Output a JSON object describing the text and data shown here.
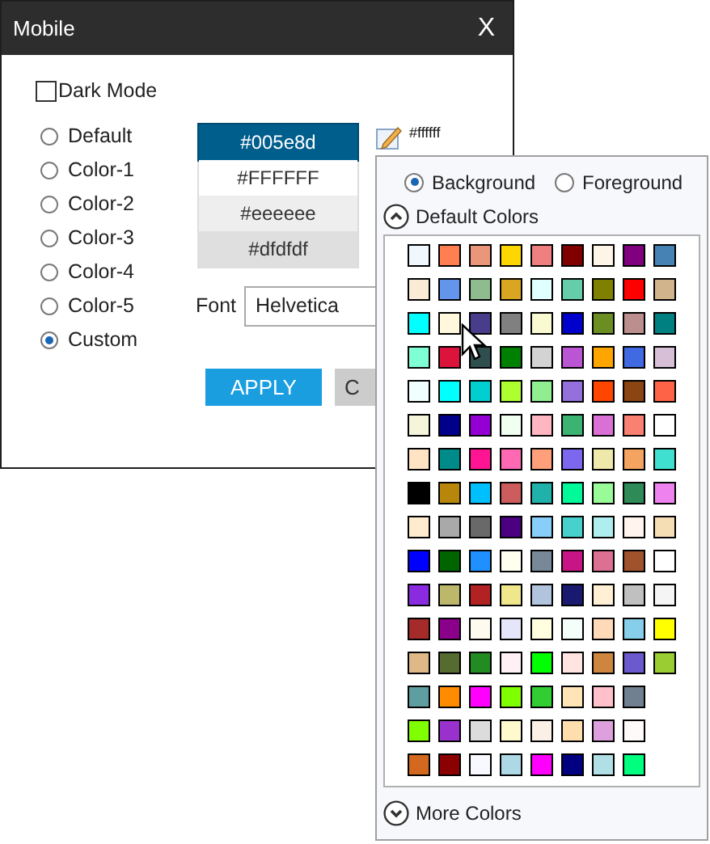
{
  "window": {
    "title": "Mobile",
    "close": "X"
  },
  "dark_mode": {
    "label": "Dark Mode",
    "checked": false
  },
  "themes": [
    {
      "label": "Default",
      "selected": false
    },
    {
      "label": "Color-1",
      "selected": false
    },
    {
      "label": "Color-2",
      "selected": false
    },
    {
      "label": "Color-3",
      "selected": false
    },
    {
      "label": "Color-4",
      "selected": false
    },
    {
      "label": "Color-5",
      "selected": false
    },
    {
      "label": "Custom",
      "selected": true
    }
  ],
  "custom_colors": [
    {
      "text": "#005e8d",
      "color": "#005e8d",
      "selected": true
    },
    {
      "text": "#FFFFFF",
      "color": "#ffffff",
      "selected": false
    },
    {
      "text": "#eeeeee",
      "color": "#eeeeee",
      "selected": false
    },
    {
      "text": "#dfdfdf",
      "color": "#dfdfdf",
      "selected": false
    }
  ],
  "font": {
    "label": "Font",
    "value": "Helvetica"
  },
  "buttons": [
    {
      "label": "APPLY",
      "kind": "primary"
    },
    {
      "label": "C",
      "kind": "secondary"
    }
  ],
  "color_picker": {
    "current": "#ffffff",
    "targets": [
      {
        "label": "Background",
        "selected": true
      },
      {
        "label": "Foreground",
        "selected": false
      }
    ],
    "section": {
      "label": "Default Colors",
      "expanded": true
    },
    "swatch_rows": [
      [
        {
          "color": "#f0f8ff"
        },
        {
          "color": "#ff7f50"
        },
        {
          "color": "#e9967a"
        },
        {
          "color": "#ffd700"
        },
        {
          "color": "#f08080"
        },
        {
          "color": "#800000"
        },
        {
          "color": "#fdf5e6"
        },
        {
          "color": "#800080"
        },
        {
          "color": "#4682b4"
        }
      ],
      [
        {
          "color": "#faebd7"
        },
        {
          "color": "#6495ed"
        },
        {
          "color": "#8fbc8f"
        },
        {
          "color": "#daa520"
        },
        {
          "color": "#e0ffff"
        },
        {
          "color": "#66cdaa"
        },
        {
          "color": "#808000"
        },
        {
          "color": "#ff0000"
        },
        {
          "color": "#d2b48c"
        }
      ],
      [
        {
          "color": "#00ffff"
        },
        {
          "color": "#fff8dc"
        },
        {
          "color": "#483d8b"
        },
        {
          "color": "#808080"
        },
        {
          "color": "#fafad2"
        },
        {
          "color": "#0000cd"
        },
        {
          "color": "#6b8e23"
        },
        {
          "color": "#bc8f8f"
        },
        {
          "color": "#008080"
        }
      ],
      [
        {
          "color": "#7fffd4"
        },
        {
          "color": "#dc143c"
        },
        {
          "color": "#2f4f4f"
        },
        {
          "color": "#008000"
        },
        {
          "color": "#d3d3d3"
        },
        {
          "color": "#ba55d3"
        },
        {
          "color": "#ffa500"
        },
        {
          "color": "#4169e1"
        },
        {
          "color": "#d8bfd8"
        }
      ],
      [
        {
          "color": "#f0ffff"
        },
        {
          "color": "#00ffff"
        },
        {
          "color": "#00ced1"
        },
        {
          "color": "#adff2f"
        },
        {
          "color": "#90ee90"
        },
        {
          "color": "#9370db"
        },
        {
          "color": "#ff4500"
        },
        {
          "color": "#8b4513"
        },
        {
          "color": "#ff6347"
        }
      ],
      [
        {
          "color": "#f5f5dc"
        },
        {
          "color": "#00008b"
        },
        {
          "color": "#9400d3"
        },
        {
          "color": "#f0fff0"
        },
        {
          "color": "#ffb6c1"
        },
        {
          "color": "#3cb371"
        },
        {
          "color": "#da70d6"
        },
        {
          "color": "#fa8072"
        },
        {
          "color": "#ffffff"
        }
      ],
      [
        {
          "color": "#ffe4c4"
        },
        {
          "color": "#008b8b"
        },
        {
          "color": "#ff1493"
        },
        {
          "color": "#ff69b4"
        },
        {
          "color": "#ffa07a"
        },
        {
          "color": "#7b68ee"
        },
        {
          "color": "#eee8aa"
        },
        {
          "color": "#f4a460"
        },
        {
          "color": "#40e0d0"
        }
      ],
      [
        {
          "color": "#000000"
        },
        {
          "color": "#b8860b"
        },
        {
          "color": "#00bfff"
        },
        {
          "color": "#cd5c5c"
        },
        {
          "color": "#20b2aa"
        },
        {
          "color": "#00fa9a"
        },
        {
          "color": "#98fb98"
        },
        {
          "color": "#2e8b57"
        },
        {
          "color": "#ee82ee"
        }
      ],
      [
        {
          "color": "#ffebcd"
        },
        {
          "color": "#a9a9a9"
        },
        {
          "color": "#696969"
        },
        {
          "color": "#4b0082"
        },
        {
          "color": "#87cefa"
        },
        {
          "color": "#48d1cc"
        },
        {
          "color": "#afeeee"
        },
        {
          "color": "#fff5ee"
        },
        {
          "color": "#f5deb3"
        }
      ],
      [
        {
          "color": "#0000ff"
        },
        {
          "color": "#006400"
        },
        {
          "color": "#1e90ff"
        },
        {
          "color": "#fffff0"
        },
        {
          "color": "#778899"
        },
        {
          "color": "#c71585"
        },
        {
          "color": "#db7093"
        },
        {
          "color": "#a0522d"
        },
        {
          "color": "#ffffff"
        }
      ],
      [
        {
          "color": "#8a2be2"
        },
        {
          "color": "#bdb76b"
        },
        {
          "color": "#b22222"
        },
        {
          "color": "#f0e68c"
        },
        {
          "color": "#b0c4de"
        },
        {
          "color": "#191970"
        },
        {
          "color": "#ffefd5"
        },
        {
          "color": "#c0c0c0"
        },
        {
          "color": "#f5f5f5"
        }
      ],
      [
        {
          "color": "#a52a2a"
        },
        {
          "color": "#8b008b"
        },
        {
          "color": "#fffaf0"
        },
        {
          "color": "#e6e6fa"
        },
        {
          "color": "#ffffe0"
        },
        {
          "color": "#f5fffa"
        },
        {
          "color": "#ffdab9"
        },
        {
          "color": "#87ceeb"
        },
        {
          "color": "#ffff00"
        }
      ],
      [
        {
          "color": "#deb887"
        },
        {
          "color": "#556b2f"
        },
        {
          "color": "#228b22"
        },
        {
          "color": "#fff0f5"
        },
        {
          "color": "#00ff00"
        },
        {
          "color": "#ffe4e1"
        },
        {
          "color": "#cd853f"
        },
        {
          "color": "#6a5acd"
        },
        {
          "color": "#9acd32"
        }
      ],
      [
        {
          "color": "#5f9ea0"
        },
        {
          "color": "#ff8c00"
        },
        {
          "color": "#ff00ff"
        },
        {
          "color": "#7fff00"
        },
        {
          "color": "#32cd32"
        },
        {
          "color": "#ffe4b5"
        },
        {
          "color": "#ffc0cb"
        },
        {
          "color": "#708090"
        }
      ],
      [
        {
          "color": "#7fff00"
        },
        {
          "color": "#9932cc"
        },
        {
          "color": "#dcdcdc"
        },
        {
          "color": "#fffacd"
        },
        {
          "color": "#faf0e6"
        },
        {
          "color": "#ffdead"
        },
        {
          "color": "#dda0dd"
        },
        {
          "color": "#fffafa"
        }
      ],
      [
        {
          "color": "#d2691e"
        },
        {
          "color": "#8b0000"
        },
        {
          "color": "#f8f8ff"
        },
        {
          "color": "#add8e6"
        },
        {
          "color": "#ff00ff"
        },
        {
          "color": "#000080"
        },
        {
          "color": "#b0e0e6"
        },
        {
          "color": "#00ff7f"
        }
      ]
    ],
    "more": {
      "label": "More Colors",
      "expanded": false
    }
  }
}
